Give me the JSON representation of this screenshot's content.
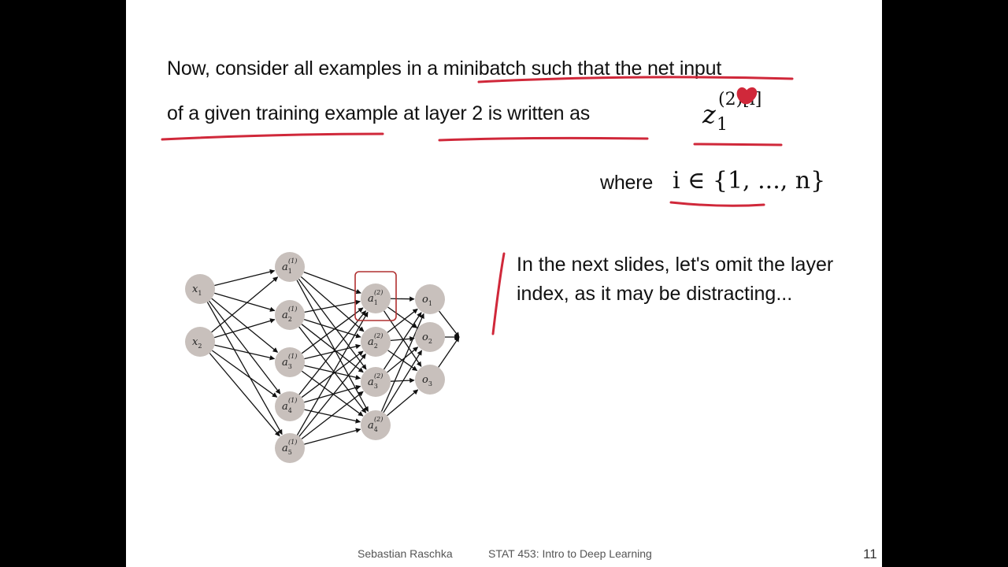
{
  "slide": {
    "text_line1": "Now, consider all examples in a minibatch such that the net input",
    "text_line2": "of a given training example  at layer 2 is written as",
    "math_z_base": "z",
    "math_z_sub": "1",
    "math_z_sup": "(2)[i]",
    "where_label": "where",
    "math_set": "i ∈ {1, ..., n}",
    "note": "In the next slides, let's omit the layer index, as it may be distracting...",
    "footer_author": "Sebastian Raschka",
    "footer_course": "STAT 453: Intro to Deep Learning",
    "page_number": "11"
  },
  "network": {
    "inputs": [
      {
        "base": "x",
        "sub": "1"
      },
      {
        "base": "x",
        "sub": "2"
      }
    ],
    "hidden1": [
      {
        "base": "a",
        "sub": "1",
        "sup": "(1)"
      },
      {
        "base": "a",
        "sub": "2",
        "sup": "(1)"
      },
      {
        "base": "a",
        "sub": "3",
        "sup": "(1)"
      },
      {
        "base": "a",
        "sub": "4",
        "sup": "(1)"
      },
      {
        "base": "a",
        "sub": "5",
        "sup": "(1)"
      }
    ],
    "hidden2": [
      {
        "base": "a",
        "sub": "1",
        "sup": "(2)"
      },
      {
        "base": "a",
        "sub": "2",
        "sup": "(2)"
      },
      {
        "base": "a",
        "sub": "3",
        "sup": "(2)"
      },
      {
        "base": "a",
        "sub": "4",
        "sup": "(2)"
      }
    ],
    "outputs": [
      {
        "base": "o",
        "sub": "1"
      },
      {
        "base": "o",
        "sub": "2"
      },
      {
        "base": "o",
        "sub": "3"
      }
    ],
    "highlighted_node": "a_1^(2)",
    "colors": {
      "node": "#c8c0bc",
      "edge": "#111111",
      "highlight": "#b03030",
      "annotation": "#d0283a"
    }
  }
}
